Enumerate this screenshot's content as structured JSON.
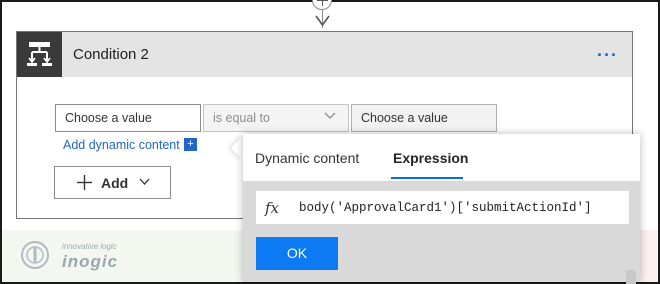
{
  "condition": {
    "title": "Condition 2",
    "more_label": "···",
    "left_value_placeholder": "Choose a value",
    "operator": "is equal to",
    "right_value_placeholder": "Choose a value",
    "add_dynamic_content": "Add dynamic content",
    "add_dynamic_icon": "+",
    "add_label": "Add"
  },
  "flyout": {
    "tabs": [
      {
        "label": "Dynamic content",
        "active": false
      },
      {
        "label": "Expression",
        "active": true
      }
    ],
    "fx_label": "fx",
    "expression": "body('ApprovalCard1')['submitActionId']",
    "ok_label": "OK"
  },
  "watermark": {
    "tagline": "innovative logic",
    "brand": "inogic"
  },
  "colors": {
    "accent": "#0a6fd8",
    "ok_button": "#0d79f2",
    "header_bg": "#e4e4e4",
    "icon_tile": "#3a3a3a"
  }
}
